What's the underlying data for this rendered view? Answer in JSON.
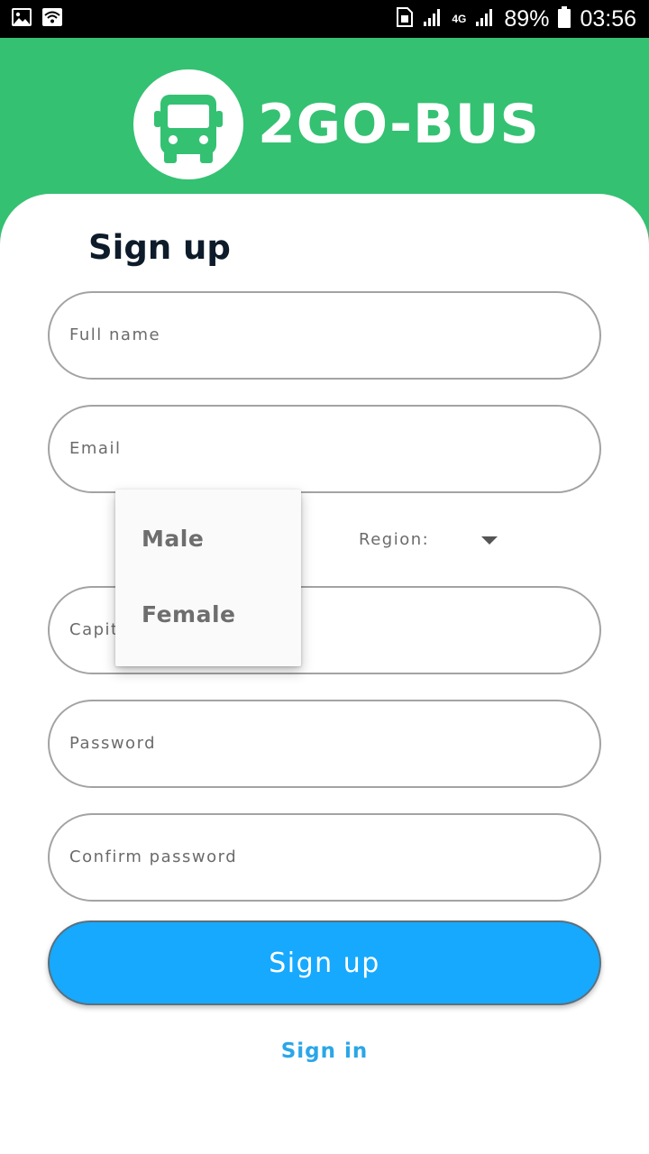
{
  "status_bar": {
    "battery": "89%",
    "time": "03:56",
    "network": "4G",
    "icons": [
      "image-icon",
      "wifi-icon",
      "sim-icon",
      "signal-icon",
      "battery-icon"
    ]
  },
  "header": {
    "brand": "2GO-BUS",
    "logo_icon": "bus-icon",
    "background_color": "#34c172"
  },
  "form": {
    "title": "Sign up",
    "full_name_placeholder": "Full name",
    "email_placeholder": "Email",
    "region_label": "Region:",
    "capital_placeholder_visible": "Capit",
    "password_placeholder": "Password",
    "confirm_password_placeholder": "Confirm password",
    "gender_dropdown": {
      "options": [
        "Male",
        "Female"
      ]
    },
    "submit_label": "Sign up",
    "submit_color": "#17a9fd",
    "signin_link": "Sign in"
  }
}
